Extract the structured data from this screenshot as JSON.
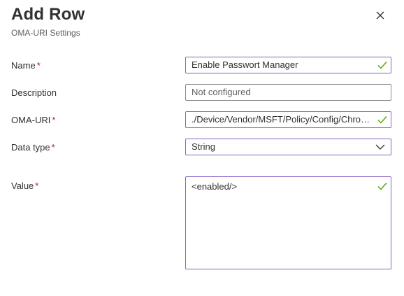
{
  "header": {
    "title": "Add Row",
    "subtitle": "OMA-URI Settings"
  },
  "form": {
    "required_marker": "*",
    "name": {
      "label": "Name",
      "value": "Enable Passwort Manager"
    },
    "description": {
      "label": "Description",
      "placeholder": "Not configured"
    },
    "oma_uri": {
      "label": "OMA-URI",
      "value": "./Device/Vendor/MSFT/Policy/Config/Chrome~Policy~googlechrome~PasswordManager/PasswordManagerEnabled"
    },
    "data_type": {
      "label": "Data type",
      "value": "String"
    },
    "value": {
      "label": "Value",
      "value": "<enabled/>"
    }
  },
  "colors": {
    "valid_check": "#57a300",
    "focus_border": "#8661c5",
    "required": "#a4262c"
  },
  "icons": {
    "close": "close-icon",
    "check": "checkmark-icon",
    "dropdown": "chevron-down-icon"
  }
}
